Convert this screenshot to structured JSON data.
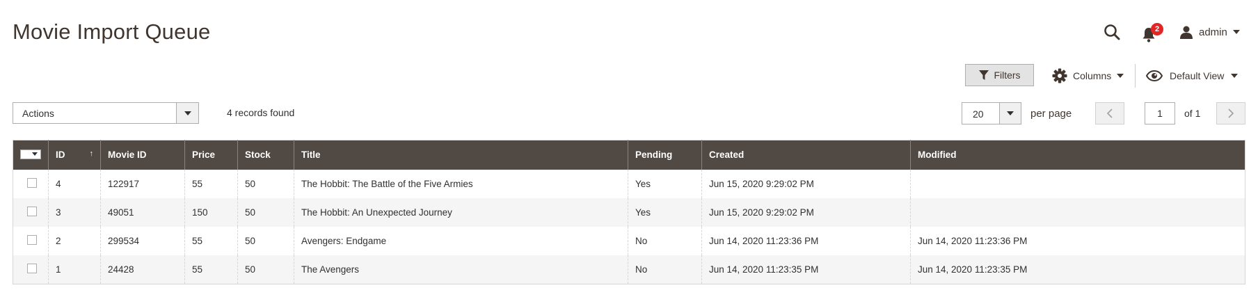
{
  "page": {
    "title": "Movie Import Queue"
  },
  "header": {
    "notifications_count": "2",
    "user_name": "admin"
  },
  "toolbar": {
    "filters_label": "Filters",
    "columns_label": "Columns",
    "view_label": "Default View",
    "actions_label": "Actions",
    "records_found": "4 records found",
    "per_page_value": "20",
    "per_page_label": "per page",
    "current_page": "1",
    "page_of": "of 1"
  },
  "grid": {
    "columns": [
      "ID",
      "Movie ID",
      "Price",
      "Stock",
      "Title",
      "Pending",
      "Created",
      "Modified"
    ],
    "rows": [
      {
        "id": "4",
        "movie_id": "122917",
        "price": "55",
        "stock": "50",
        "title": "The Hobbit: The Battle of the Five Armies",
        "pending": "Yes",
        "created": "Jun 15, 2020 9:29:02 PM",
        "modified": ""
      },
      {
        "id": "3",
        "movie_id": "49051",
        "price": "150",
        "stock": "50",
        "title": "The Hobbit: An Unexpected Journey",
        "pending": "Yes",
        "created": "Jun 15, 2020 9:29:02 PM",
        "modified": ""
      },
      {
        "id": "2",
        "movie_id": "299534",
        "price": "55",
        "stock": "50",
        "title": "Avengers: Endgame",
        "pending": "No",
        "created": "Jun 14, 2020 11:23:36 PM",
        "modified": "Jun 14, 2020 11:23:36 PM"
      },
      {
        "id": "1",
        "movie_id": "24428",
        "price": "55",
        "stock": "50",
        "title": "The Avengers",
        "pending": "No",
        "created": "Jun 14, 2020 11:23:35 PM",
        "modified": "Jun 14, 2020 11:23:35 PM"
      }
    ]
  },
  "icons": {
    "search": "search-icon",
    "bell": "bell-icon",
    "user": "user-icon",
    "filter": "filter-icon",
    "gear": "gear-icon",
    "eye": "eye-icon"
  },
  "colors": {
    "header_bg": "#514943",
    "badge": "#e22626",
    "title": "#41362f"
  }
}
